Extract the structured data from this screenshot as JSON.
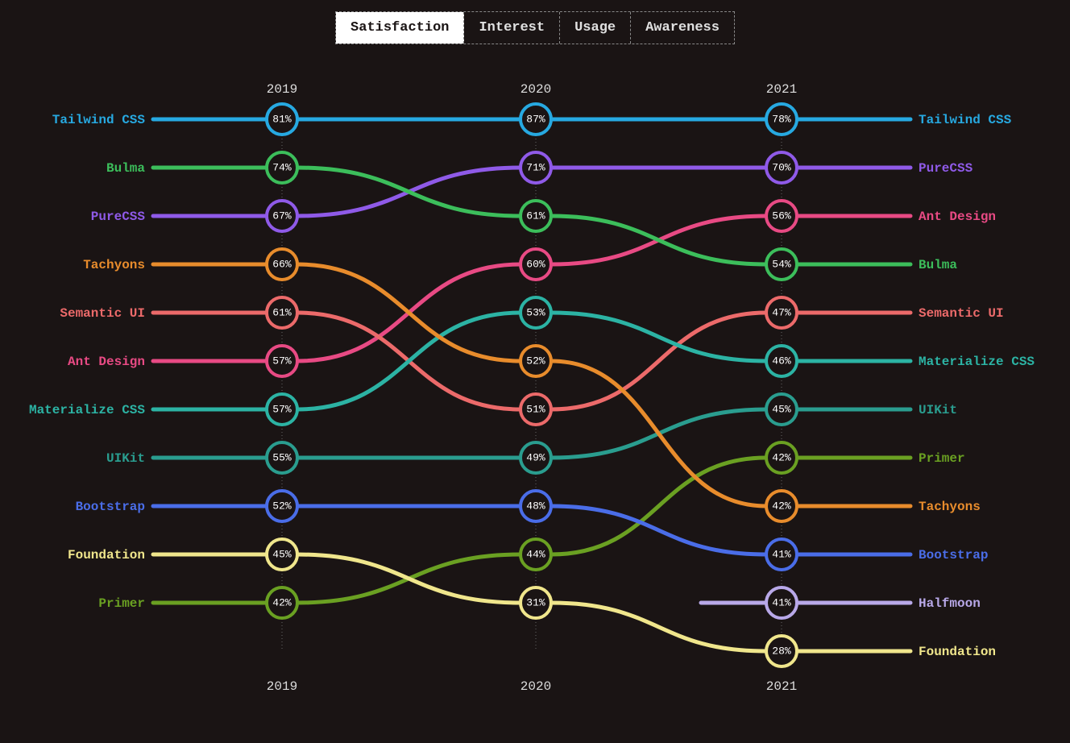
{
  "tabs": [
    {
      "id": "satisfaction",
      "label": "Satisfaction",
      "active": true
    },
    {
      "id": "interest",
      "label": "Interest",
      "active": false
    },
    {
      "id": "usage",
      "label": "Usage",
      "active": false
    },
    {
      "id": "awareness",
      "label": "Awareness",
      "active": false
    }
  ],
  "chart_data": {
    "type": "bump",
    "title": "",
    "years": [
      "2019",
      "2020",
      "2021"
    ],
    "row_spacing": 60,
    "top_offset": 155,
    "columns_x": [
      350,
      665,
      970
    ],
    "label_left_x": 180,
    "label_right_x": 1140,
    "node_radius": 19,
    "series": [
      {
        "name": "Tailwind CSS",
        "color": "#27a9e1",
        "ranks": [
          1,
          1,
          1
        ],
        "values": [
          81,
          87,
          78
        ]
      },
      {
        "name": "PureCSS",
        "color": "#8f5ae8",
        "ranks": [
          3,
          2,
          2
        ],
        "values": [
          67,
          71,
          70
        ]
      },
      {
        "name": "Ant Design",
        "color": "#e84a84",
        "ranks": [
          6,
          4,
          3
        ],
        "values": [
          57,
          60,
          56
        ]
      },
      {
        "name": "Bulma",
        "color": "#3cbe5b",
        "ranks": [
          2,
          3,
          4
        ],
        "values": [
          74,
          61,
          54
        ]
      },
      {
        "name": "Semantic UI",
        "color": "#ec6a6a",
        "ranks": [
          5,
          7,
          5
        ],
        "values": [
          61,
          51,
          47
        ]
      },
      {
        "name": "Materialize CSS",
        "color": "#2cb3a4",
        "ranks": [
          7,
          5,
          6
        ],
        "values": [
          57,
          53,
          46
        ]
      },
      {
        "name": "UIKit",
        "color": "#2a9d8f",
        "ranks": [
          8,
          8,
          7
        ],
        "values": [
          55,
          49,
          45
        ]
      },
      {
        "name": "Primer",
        "color": "#6aa022",
        "ranks": [
          11,
          10,
          8
        ],
        "values": [
          42,
          44,
          42
        ]
      },
      {
        "name": "Tachyons",
        "color": "#e88c2c",
        "ranks": [
          4,
          6,
          9
        ],
        "values": [
          66,
          52,
          42
        ]
      },
      {
        "name": "Bootstrap",
        "color": "#4a6de8",
        "ranks": [
          9,
          9,
          10
        ],
        "values": [
          52,
          48,
          41
        ]
      },
      {
        "name": "Halfmoon",
        "color": "#b8a8e8",
        "ranks": [
          null,
          null,
          11
        ],
        "values": [
          null,
          null,
          41
        ]
      },
      {
        "name": "Foundation",
        "color": "#f0e68c",
        "ranks": [
          10,
          11,
          12
        ],
        "values": [
          45,
          31,
          28
        ]
      }
    ],
    "left_order": [
      "Tailwind CSS",
      "Bulma",
      "PureCSS",
      "Tachyons",
      "Semantic UI",
      "Ant Design",
      "Materialize CSS",
      "UIKit",
      "Bootstrap",
      "Foundation",
      "Primer"
    ],
    "right_order": [
      "Tailwind CSS",
      "PureCSS",
      "Ant Design",
      "Bulma",
      "Semantic UI",
      "Materialize CSS",
      "UIKit",
      "Primer",
      "Tachyons",
      "Bootstrap",
      "Halfmoon",
      "Foundation"
    ]
  }
}
